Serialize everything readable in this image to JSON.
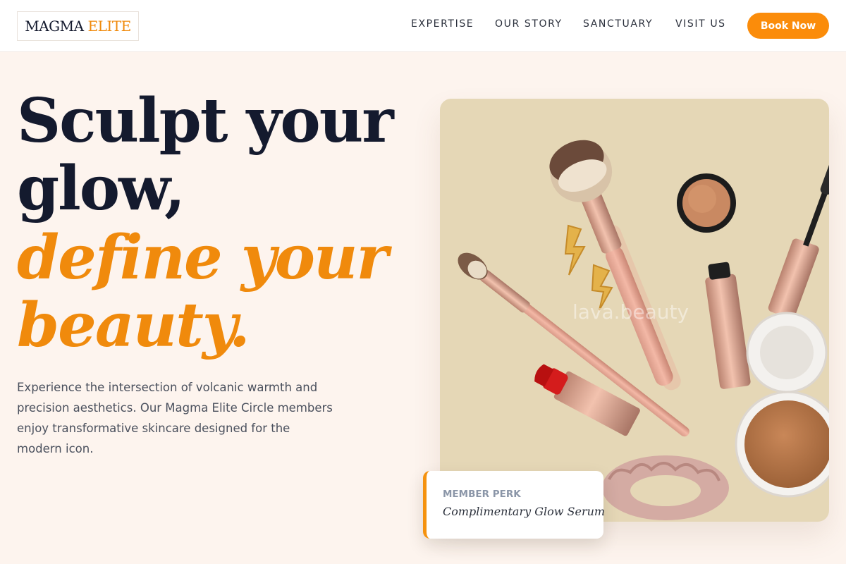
{
  "brand": {
    "name_primary": "MAGMA",
    "name_accent": "ELITE"
  },
  "nav": {
    "items": [
      "EXPERTISE",
      "OUR STORY",
      "SANCTUARY",
      "VISIT US"
    ],
    "cta": "Book Now"
  },
  "hero": {
    "line1": "Sculpt your",
    "line2": "glow,",
    "line3": "define your",
    "line4": "beauty.",
    "description": "Experience the intersection of volcanic warmth and precision aesthetics. Our Magma Elite Circle members enjoy transformative skincare designed for the modern icon."
  },
  "image": {
    "watermark": "lava.beauty",
    "subject": "flat-lay of makeup brushes, mascara, lipstick, compact powder, rouge pot and velvet scrunchie on beige background"
  },
  "perk": {
    "label": "MEMBER PERK",
    "value": "Complimentary Glow Serum"
  },
  "colors": {
    "accent": "#f08a0c",
    "button": "#fb8c0a",
    "text_dark": "#141a2e",
    "page_bg": "#fdf4ee",
    "photo_bg": "#e5d7b6"
  }
}
